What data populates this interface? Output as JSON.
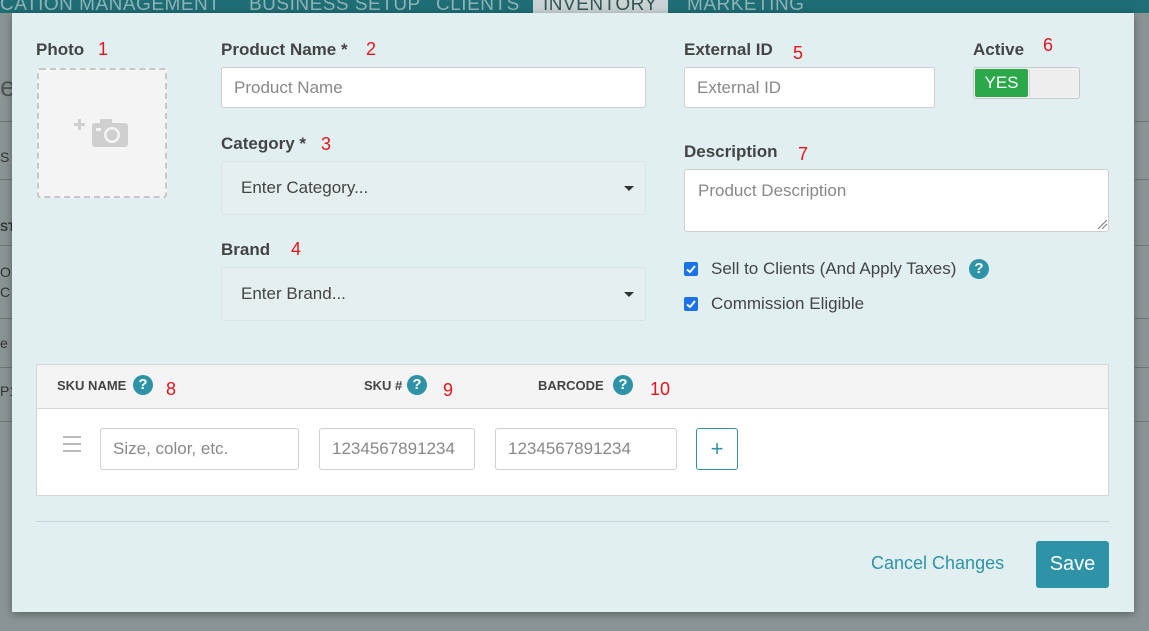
{
  "background": {
    "nav_items": [
      "CATION MANAGEMENT",
      "BUSINESS SETUP",
      "CLIENTS",
      "INVENTORY",
      "MARKETING"
    ],
    "fragments": [
      "e",
      "S",
      "ST",
      "O",
      "C",
      "e",
      "P1"
    ]
  },
  "form": {
    "photo": {
      "label": "Photo",
      "marker": "1"
    },
    "product_name": {
      "label": "Product Name *",
      "marker": "2",
      "placeholder": "Product Name",
      "value": ""
    },
    "category": {
      "label": "Category *",
      "marker": "3",
      "placeholder": "Enter Category..."
    },
    "brand": {
      "label": "Brand",
      "marker": "4",
      "placeholder": "Enter Brand..."
    },
    "external_id": {
      "label": "External ID",
      "marker": "5",
      "placeholder": "External ID",
      "value": ""
    },
    "active": {
      "label": "Active",
      "marker": "6",
      "toggle_label": "YES",
      "on": true
    },
    "description": {
      "label": "Description",
      "marker": "7",
      "placeholder": "Product Description"
    },
    "sell_to_clients": {
      "label": "Sell to Clients (And Apply Taxes)",
      "checked": true
    },
    "commission_eligible": {
      "label": "Commission Eligible",
      "checked": true
    }
  },
  "sku": {
    "columns": [
      {
        "label": "SKU NAME",
        "marker": "8"
      },
      {
        "label": "SKU #",
        "marker": "9"
      },
      {
        "label": "BARCODE",
        "marker": "10"
      }
    ],
    "row": {
      "name_placeholder": "Size, color, etc.",
      "sku_placeholder": "1234567891234",
      "barcode_placeholder": "1234567891234"
    },
    "add_label": "+"
  },
  "help_glyph": "?",
  "actions": {
    "cancel_label": "Cancel Changes",
    "save_label": "Save"
  },
  "colors": {
    "accent": "#2f93a7",
    "toggle_on": "#2aa84a",
    "marker": "#e3141c",
    "modal_bg": "#e1eff1",
    "checkbox": "#1a73e8"
  },
  "icons": [
    "camera-add-icon",
    "caret-down-icon",
    "help-icon",
    "drag-handle-icon",
    "resize-grip-icon",
    "checkmark-icon"
  ]
}
